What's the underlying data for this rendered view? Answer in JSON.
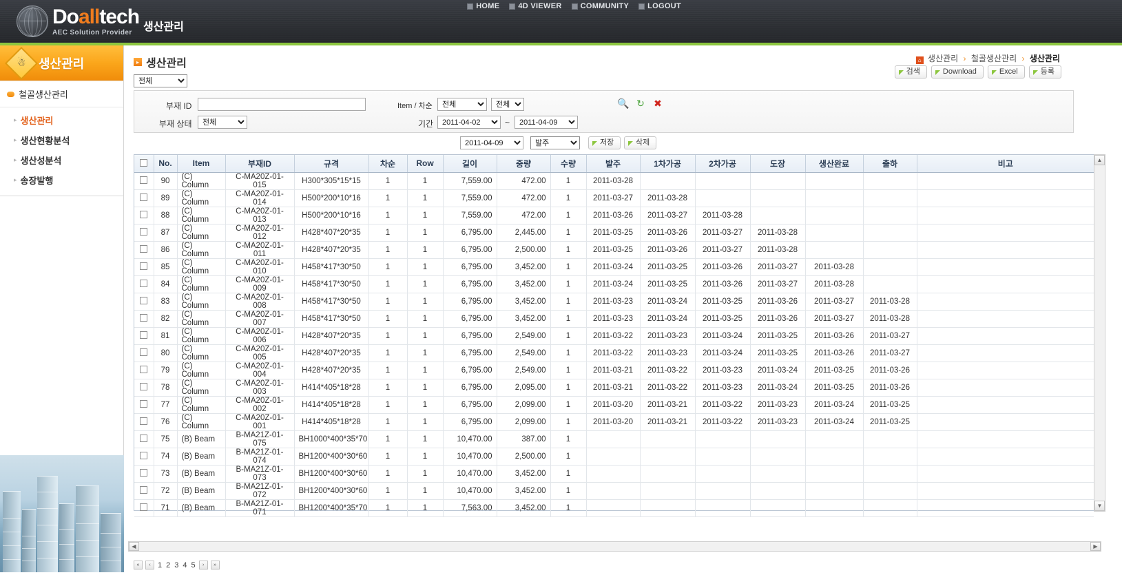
{
  "header": {
    "logo_main_1": "Do",
    "logo_main_2": "all",
    "logo_main_3": "tech",
    "logo_sub": "AEC Solution Provider",
    "app_title": "생산관리",
    "nav": [
      {
        "label": "HOME",
        "icon": "home-icon"
      },
      {
        "label": "4D VIEWER",
        "icon": "viewer-icon"
      },
      {
        "label": "COMMUNITY",
        "icon": "community-icon"
      },
      {
        "label": "LOGOUT",
        "icon": "logout-icon"
      }
    ]
  },
  "sidebar": {
    "title": "생산관리",
    "group": "철골생산관리",
    "items": [
      {
        "label": "생산관리",
        "active": true
      },
      {
        "label": "생산현황분석",
        "active": false
      },
      {
        "label": "생산성분석",
        "active": false
      },
      {
        "label": "송장발행",
        "active": false
      }
    ]
  },
  "main": {
    "page_title": "생산관리",
    "breadcrumb": [
      "생산관리",
      "철골생산관리",
      "생산관리"
    ],
    "top_select": "전체",
    "buttons": [
      {
        "label": "검색"
      },
      {
        "label": "Download"
      },
      {
        "label": "Excel"
      },
      {
        "label": "등록"
      }
    ],
    "search": {
      "bujae_id_label": "부재 ID",
      "bujae_id_value": "",
      "bujae_state_label": "부재 상태",
      "bujae_state_value": "전체",
      "item_chasun_label": "Item / 차순",
      "item_value": "전체",
      "chasun_value": "전체",
      "gigan_label": "기간",
      "date_from": "2011-04-02",
      "date_to": "2011-04-09",
      "tilde": "~",
      "icons": [
        "search-icon",
        "refresh-icon",
        "close-icon"
      ]
    },
    "toolbar2": {
      "date": "2011-04-09",
      "stage": "발주",
      "save_label": "저장",
      "delete_label": "삭제"
    },
    "table": {
      "columns": [
        "",
        "No.",
        "Item",
        "부재ID",
        "규격",
        "차순",
        "Row",
        "길이",
        "중량",
        "수량",
        "발주",
        "1차가공",
        "2차가공",
        "도장",
        "생산완료",
        "출하",
        "비고"
      ],
      "rows": [
        {
          "no": "90",
          "item": "(C) Column",
          "bujae_id": "C-MA20Z-01-015",
          "spec": "H300*305*15*15",
          "chasun": "1",
          "row": "1",
          "length": "7,559.00",
          "weight": "472.00",
          "qty": "1",
          "order": "2011-03-28",
          "proc1": "",
          "proc2": "",
          "paint": "",
          "done": "",
          "ship": "",
          "note": ""
        },
        {
          "no": "89",
          "item": "(C) Column",
          "bujae_id": "C-MA20Z-01-014",
          "spec": "H500*200*10*16",
          "chasun": "1",
          "row": "1",
          "length": "7,559.00",
          "weight": "472.00",
          "qty": "1",
          "order": "2011-03-27",
          "proc1": "2011-03-28",
          "proc2": "",
          "paint": "",
          "done": "",
          "ship": "",
          "note": ""
        },
        {
          "no": "88",
          "item": "(C) Column",
          "bujae_id": "C-MA20Z-01-013",
          "spec": "H500*200*10*16",
          "chasun": "1",
          "row": "1",
          "length": "7,559.00",
          "weight": "472.00",
          "qty": "1",
          "order": "2011-03-26",
          "proc1": "2011-03-27",
          "proc2": "2011-03-28",
          "paint": "",
          "done": "",
          "ship": "",
          "note": ""
        },
        {
          "no": "87",
          "item": "(C) Column",
          "bujae_id": "C-MA20Z-01-012",
          "spec": "H428*407*20*35",
          "chasun": "1",
          "row": "1",
          "length": "6,795.00",
          "weight": "2,445.00",
          "qty": "1",
          "order": "2011-03-25",
          "proc1": "2011-03-26",
          "proc2": "2011-03-27",
          "paint": "2011-03-28",
          "done": "",
          "ship": "",
          "note": ""
        },
        {
          "no": "86",
          "item": "(C) Column",
          "bujae_id": "C-MA20Z-01-011",
          "spec": "H428*407*20*35",
          "chasun": "1",
          "row": "1",
          "length": "6,795.00",
          "weight": "2,500.00",
          "qty": "1",
          "order": "2011-03-25",
          "proc1": "2011-03-26",
          "proc2": "2011-03-27",
          "paint": "2011-03-28",
          "done": "",
          "ship": "",
          "note": ""
        },
        {
          "no": "85",
          "item": "(C) Column",
          "bujae_id": "C-MA20Z-01-010",
          "spec": "H458*417*30*50",
          "chasun": "1",
          "row": "1",
          "length": "6,795.00",
          "weight": "3,452.00",
          "qty": "1",
          "order": "2011-03-24",
          "proc1": "2011-03-25",
          "proc2": "2011-03-26",
          "paint": "2011-03-27",
          "done": "2011-03-28",
          "ship": "",
          "note": ""
        },
        {
          "no": "84",
          "item": "(C) Column",
          "bujae_id": "C-MA20Z-01-009",
          "spec": "H458*417*30*50",
          "chasun": "1",
          "row": "1",
          "length": "6,795.00",
          "weight": "3,452.00",
          "qty": "1",
          "order": "2011-03-24",
          "proc1": "2011-03-25",
          "proc2": "2011-03-26",
          "paint": "2011-03-27",
          "done": "2011-03-28",
          "ship": "",
          "note": ""
        },
        {
          "no": "83",
          "item": "(C) Column",
          "bujae_id": "C-MA20Z-01-008",
          "spec": "H458*417*30*50",
          "chasun": "1",
          "row": "1",
          "length": "6,795.00",
          "weight": "3,452.00",
          "qty": "1",
          "order": "2011-03-23",
          "proc1": "2011-03-24",
          "proc2": "2011-03-25",
          "paint": "2011-03-26",
          "done": "2011-03-27",
          "ship": "2011-03-28",
          "note": ""
        },
        {
          "no": "82",
          "item": "(C) Column",
          "bujae_id": "C-MA20Z-01-007",
          "spec": "H458*417*30*50",
          "chasun": "1",
          "row": "1",
          "length": "6,795.00",
          "weight": "3,452.00",
          "qty": "1",
          "order": "2011-03-23",
          "proc1": "2011-03-24",
          "proc2": "2011-03-25",
          "paint": "2011-03-26",
          "done": "2011-03-27",
          "ship": "2011-03-28",
          "note": ""
        },
        {
          "no": "81",
          "item": "(C) Column",
          "bujae_id": "C-MA20Z-01-006",
          "spec": "H428*407*20*35",
          "chasun": "1",
          "row": "1",
          "length": "6,795.00",
          "weight": "2,549.00",
          "qty": "1",
          "order": "2011-03-22",
          "proc1": "2011-03-23",
          "proc2": "2011-03-24",
          "paint": "2011-03-25",
          "done": "2011-03-26",
          "ship": "2011-03-27",
          "note": ""
        },
        {
          "no": "80",
          "item": "(C) Column",
          "bujae_id": "C-MA20Z-01-005",
          "spec": "H428*407*20*35",
          "chasun": "1",
          "row": "1",
          "length": "6,795.00",
          "weight": "2,549.00",
          "qty": "1",
          "order": "2011-03-22",
          "proc1": "2011-03-23",
          "proc2": "2011-03-24",
          "paint": "2011-03-25",
          "done": "2011-03-26",
          "ship": "2011-03-27",
          "note": ""
        },
        {
          "no": "79",
          "item": "(C) Column",
          "bujae_id": "C-MA20Z-01-004",
          "spec": "H428*407*20*35",
          "chasun": "1",
          "row": "1",
          "length": "6,795.00",
          "weight": "2,549.00",
          "qty": "1",
          "order": "2011-03-21",
          "proc1": "2011-03-22",
          "proc2": "2011-03-23",
          "paint": "2011-03-24",
          "done": "2011-03-25",
          "ship": "2011-03-26",
          "note": ""
        },
        {
          "no": "78",
          "item": "(C) Column",
          "bujae_id": "C-MA20Z-01-003",
          "spec": "H414*405*18*28",
          "chasun": "1",
          "row": "1",
          "length": "6,795.00",
          "weight": "2,095.00",
          "qty": "1",
          "order": "2011-03-21",
          "proc1": "2011-03-22",
          "proc2": "2011-03-23",
          "paint": "2011-03-24",
          "done": "2011-03-25",
          "ship": "2011-03-26",
          "note": ""
        },
        {
          "no": "77",
          "item": "(C) Column",
          "bujae_id": "C-MA20Z-01-002",
          "spec": "H414*405*18*28",
          "chasun": "1",
          "row": "1",
          "length": "6,795.00",
          "weight": "2,099.00",
          "qty": "1",
          "order": "2011-03-20",
          "proc1": "2011-03-21",
          "proc2": "2011-03-22",
          "paint": "2011-03-23",
          "done": "2011-03-24",
          "ship": "2011-03-25",
          "note": ""
        },
        {
          "no": "76",
          "item": "(C) Column",
          "bujae_id": "C-MA20Z-01-001",
          "spec": "H414*405*18*28",
          "chasun": "1",
          "row": "1",
          "length": "6,795.00",
          "weight": "2,099.00",
          "qty": "1",
          "order": "2011-03-20",
          "proc1": "2011-03-21",
          "proc2": "2011-03-22",
          "paint": "2011-03-23",
          "done": "2011-03-24",
          "ship": "2011-03-25",
          "note": ""
        },
        {
          "no": "75",
          "item": "(B) Beam",
          "bujae_id": "B-MA21Z-01-075",
          "spec": "BH1000*400*35*70",
          "chasun": "1",
          "row": "1",
          "length": "10,470.00",
          "weight": "387.00",
          "qty": "1",
          "order": "",
          "proc1": "",
          "proc2": "",
          "paint": "",
          "done": "",
          "ship": "",
          "note": ""
        },
        {
          "no": "74",
          "item": "(B) Beam",
          "bujae_id": "B-MA21Z-01-074",
          "spec": "BH1200*400*30*60",
          "chasun": "1",
          "row": "1",
          "length": "10,470.00",
          "weight": "2,500.00",
          "qty": "1",
          "order": "",
          "proc1": "",
          "proc2": "",
          "paint": "",
          "done": "",
          "ship": "",
          "note": ""
        },
        {
          "no": "73",
          "item": "(B) Beam",
          "bujae_id": "B-MA21Z-01-073",
          "spec": "BH1200*400*30*60",
          "chasun": "1",
          "row": "1",
          "length": "10,470.00",
          "weight": "3,452.00",
          "qty": "1",
          "order": "",
          "proc1": "",
          "proc2": "",
          "paint": "",
          "done": "",
          "ship": "",
          "note": ""
        },
        {
          "no": "72",
          "item": "(B) Beam",
          "bujae_id": "B-MA21Z-01-072",
          "spec": "BH1200*400*30*60",
          "chasun": "1",
          "row": "1",
          "length": "10,470.00",
          "weight": "3,452.00",
          "qty": "1",
          "order": "",
          "proc1": "",
          "proc2": "",
          "paint": "",
          "done": "",
          "ship": "",
          "note": ""
        },
        {
          "no": "71",
          "item": "(B) Beam",
          "bujae_id": "B-MA21Z-01-071",
          "spec": "BH1200*400*35*70",
          "chasun": "1",
          "row": "1",
          "length": "7,563.00",
          "weight": "3,452.00",
          "qty": "1",
          "order": "",
          "proc1": "",
          "proc2": "",
          "paint": "",
          "done": "",
          "ship": "",
          "note": ""
        }
      ]
    },
    "pagination": {
      "first": "«",
      "prev": "‹",
      "pages": [
        "1",
        "2",
        "3",
        "4",
        "5"
      ],
      "next": "›",
      "last": "»"
    }
  },
  "colors": {
    "accent_green": "#8cc63e",
    "accent_orange": "#f08c0a",
    "header_bg": "#2b2e33",
    "active_link": "#e2601a"
  }
}
